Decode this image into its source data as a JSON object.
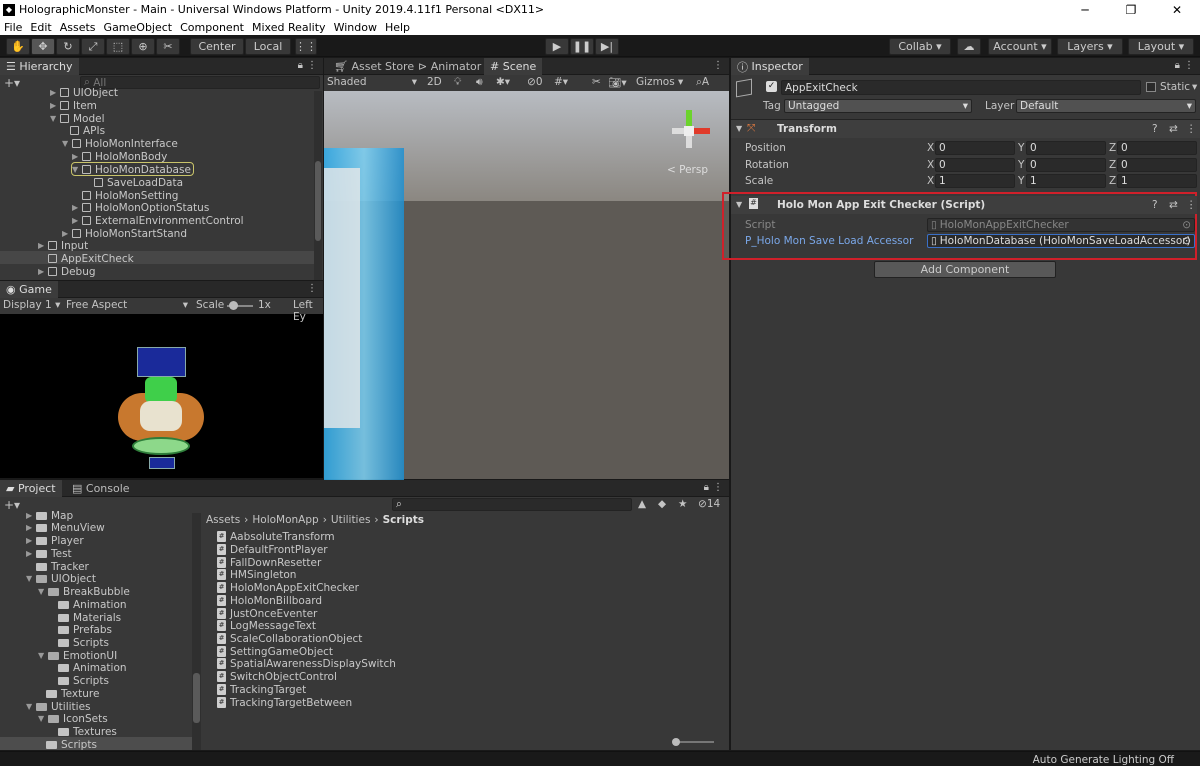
{
  "window": {
    "title": "HolographicMonster - Main - Universal Windows Platform - Unity 2019.4.11f1 Personal <DX11>",
    "min": "─",
    "max": "❐",
    "close": "✕"
  },
  "menu": [
    "File",
    "Edit",
    "Assets",
    "GameObject",
    "Component",
    "Mixed Reality",
    "Window",
    "Help"
  ],
  "toolbar": {
    "pivot": "Center",
    "space": "Local",
    "collab": "Collab ▾",
    "account": "Account",
    "layers": "Layers",
    "layout": "Layout"
  },
  "hierarchy": {
    "tab": "Hierarchy",
    "search_placeholder": "All",
    "items": [
      "UIObject",
      "Item",
      "Model",
      "APIs",
      "HoloMonInterface",
      "HoloMonBody",
      "HoloMonDatabase",
      "SaveLoadData",
      "HoloMonSetting",
      "HoloMonOptionStatus",
      "ExternalEnvironmentControl",
      "HoloMonStartStand",
      "Input",
      "AppExitCheck",
      "Debug"
    ]
  },
  "game": {
    "tab": "Game",
    "display": "Display 1",
    "aspect": "Free Aspect",
    "scale_label": "Scale",
    "scale_value": "1x",
    "left_eye": "Left Ey"
  },
  "center_tabs": [
    "Asset Store",
    "Animator",
    "Scene"
  ],
  "scene": {
    "shading": "Shaded",
    "mode2d": "2D",
    "hidden_count": "0",
    "gizmos": "Gizmos",
    "persp": "< Persp"
  },
  "inspector": {
    "tab": "Inspector",
    "object_name": "AppExitCheck",
    "static_label": "Static",
    "tag_label": "Tag",
    "tag_value": "Untagged",
    "layer_label": "Layer",
    "layer_value": "Default",
    "transform": {
      "title": "Transform",
      "position_label": "Position",
      "rotation_label": "Rotation",
      "scale_label": "Scale",
      "position": [
        "0",
        "0",
        "0"
      ],
      "rotation": [
        "0",
        "0",
        "0"
      ],
      "scale": [
        "1",
        "1",
        "1"
      ],
      "axes": [
        "X",
        "Y",
        "Z"
      ]
    },
    "script_comp": {
      "title": "Holo Mon App Exit Checker (Script)",
      "script_label": "Script",
      "script_value": "HoloMonAppExitChecker",
      "accessor_label": "P_Holo Mon Save Load Accessor",
      "accessor_value": "HoloMonDatabase (HoloMonSaveLoadAccessor)"
    },
    "add_component": "Add Component"
  },
  "project": {
    "tabs": [
      "Project",
      "Console"
    ],
    "count": "14",
    "breadcrumb": [
      "Assets",
      "HoloMonApp",
      "Utilities",
      "Scripts"
    ],
    "folders": [
      "Map",
      "MenuView",
      "Player",
      "Test",
      "Tracker",
      "UIObject",
      "BreakBubble",
      "Animation",
      "Materials",
      "Prefabs",
      "Scripts",
      "EmotionUI",
      "Animation",
      "Scripts",
      "Texture",
      "Utilities",
      "IconSets",
      "Textures",
      "Scripts"
    ],
    "scripts": [
      "AabsoluteTransform",
      "DefaultFrontPlayer",
      "FallDownResetter",
      "HMSingleton",
      "HoloMonAppExitChecker",
      "HoloMonBillboard",
      "JustOnceEventer",
      "LogMessageText",
      "ScaleCollaborationObject",
      "SettingGameObject",
      "SpatialAwarenessDisplaySwitch",
      "SwitchObjectControl",
      "TrackingTarget",
      "TrackingTargetBetween"
    ]
  },
  "status": {
    "text": "Auto Generate Lighting Off"
  },
  "colors": {
    "highlight_box": "#d0202a",
    "selection_outline": "#c9c46a",
    "link_blue": "#7aa7e8"
  }
}
